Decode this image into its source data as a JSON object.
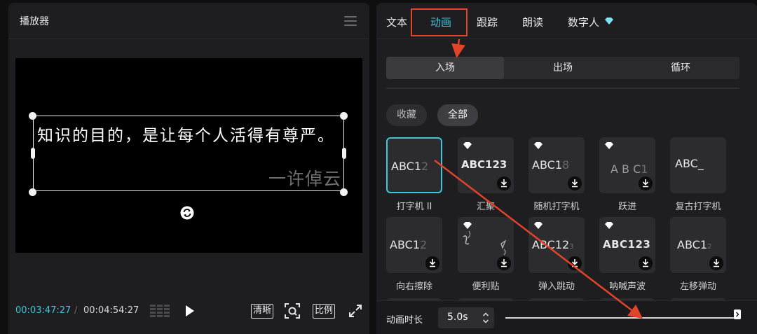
{
  "player": {
    "title": "播放器",
    "subtitle": "知识的目的，是让每个人活得有尊严。",
    "watermark": "一许倬云",
    "time_current": "00:03:47:27",
    "time_separator": "/",
    "time_total": "00:04:54:27",
    "btn_clear": "清晰",
    "btn_ratio": "比例"
  },
  "tabs": [
    {
      "label": "文本"
    },
    {
      "label": "动画"
    },
    {
      "label": "跟踪"
    },
    {
      "label": "朗读"
    },
    {
      "label": "数字人"
    }
  ],
  "segments": [
    {
      "label": "入场"
    },
    {
      "label": "出场"
    },
    {
      "label": "循环"
    }
  ],
  "filters": [
    {
      "label": "收藏"
    },
    {
      "label": "全部"
    }
  ],
  "effects": [
    {
      "label": "打字机 II",
      "preview": "ABC1",
      "preview_dim": "2"
    },
    {
      "label": "汇聚",
      "preview": "ABC123",
      "preview_dim": ""
    },
    {
      "label": "随机打字机",
      "preview": "ABC1",
      "preview_dim": "8"
    },
    {
      "label": "跃进",
      "preview": "A B C",
      "preview_dim": "1"
    },
    {
      "label": "复古打字机",
      "preview": "ABC_",
      "preview_dim": ""
    },
    {
      "label": "向右擦除",
      "preview": "ABC1",
      "preview_dim": "2"
    },
    {
      "label": "便利贴",
      "preview": "",
      "preview_dim": ""
    },
    {
      "label": "弹入跳动",
      "preview": "ABC12",
      "preview_dim": "3"
    },
    {
      "label": "呐喊声波",
      "preview": "ABC123",
      "preview_dim": ""
    },
    {
      "label": "左移弹动",
      "preview": "ABC1",
      "preview_dim": "2"
    }
  ],
  "duration": {
    "label": "动画时长",
    "value": "5.0s",
    "slider_fraction": 1.0
  },
  "colors": {
    "accent": "#3ec7d8",
    "annotation": "#e2432a",
    "premium": "#7fe3f5"
  }
}
